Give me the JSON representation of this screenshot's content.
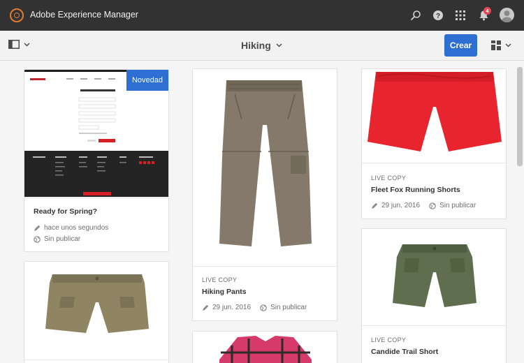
{
  "shell": {
    "app_title": "Adobe Experience Manager",
    "notification_count": "4",
    "icons": [
      "search-icon",
      "help-icon",
      "solutions-icon",
      "bell-icon",
      "user-avatar"
    ]
  },
  "actionbar": {
    "page_title": "Hiking",
    "create_label": "Crear"
  },
  "colors": {
    "shell_bg": "#323232",
    "accent": "#2d6fd3",
    "logo": "#e07b33",
    "badge": "#e34850"
  },
  "cards": [
    {
      "badge": "Novedad",
      "context": "",
      "title": "Ready for Spring?",
      "modified": "hace unos segundos",
      "status": "Sin publicar",
      "preview": {
        "heading": "CREATE AN ACCOUNT",
        "cta": "Submit",
        "footer_button": "Sign in to Your Store"
      }
    },
    {
      "badge": "",
      "context": "LIVE COPY",
      "title": "Hiking Pants",
      "modified": "29 jun. 2016",
      "status": "Sin publicar"
    },
    {
      "badge": "",
      "context": "LIVE COPY",
      "title": "Fleet Fox Running Shorts",
      "modified": "29 jun. 2016",
      "status": "Sin publicar"
    },
    {
      "badge": "",
      "context": "LIVE COPY",
      "title": "Candide Trail Short",
      "modified": "",
      "status": ""
    }
  ]
}
